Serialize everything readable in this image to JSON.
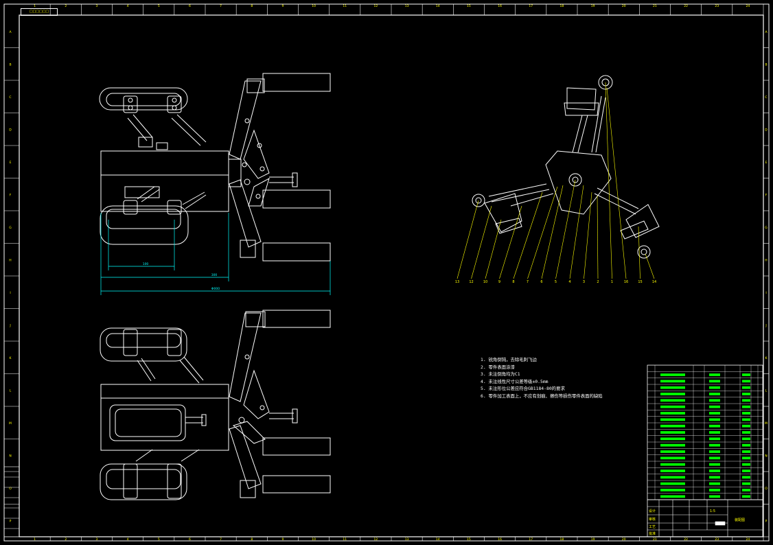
{
  "sheet": {
    "tag": "□□□□□□",
    "col_ticks": [
      "1",
      "2",
      "3",
      "4",
      "5",
      "6",
      "7",
      "8",
      "9",
      "10",
      "11",
      "12",
      "13",
      "14",
      "15",
      "16",
      "17",
      "18",
      "19",
      "20",
      "21",
      "22",
      "23",
      "24"
    ],
    "row_ticks": [
      "A",
      "B",
      "C",
      "D",
      "E",
      "F",
      "G",
      "H",
      "I",
      "J",
      "K",
      "L",
      "M",
      "N",
      "O",
      "P"
    ]
  },
  "views": {
    "top_view_dims": [
      "100",
      "300",
      "Φ000"
    ],
    "callouts": [
      "13",
      "12",
      "10",
      "9",
      "8",
      "7",
      "6",
      "5",
      "4",
      "3",
      "2",
      "1",
      "16",
      "15",
      "14"
    ]
  },
  "notes": [
    "1. 锐角倒钝，去除毛刺飞边",
    "2. 零件表面涂漆",
    "3. 未注倒角均为C1",
    "4. 未注线性尺寸公差等级±0.5mm",
    "5. 未注形位公差应符合GB1184-80的要求",
    "6. 零件加工表面上，不应有划痕、擦伤等损伤零件表面的缺陷"
  ],
  "bom": {
    "header": [
      "序号",
      "代 号",
      "名 称",
      "数量",
      "材 料",
      "重量",
      "比例",
      "备注"
    ],
    "rows": 21
  },
  "title_block": {
    "labels": [
      "设计",
      "审核",
      "工艺",
      "批准"
    ],
    "name": "装配图",
    "scale": "1:5"
  },
  "colors": {
    "line": "#ffffff",
    "dimension": "#00ffff",
    "leader": "#ffff00",
    "table_text": "#00ff00",
    "frame": "#ffffff"
  }
}
